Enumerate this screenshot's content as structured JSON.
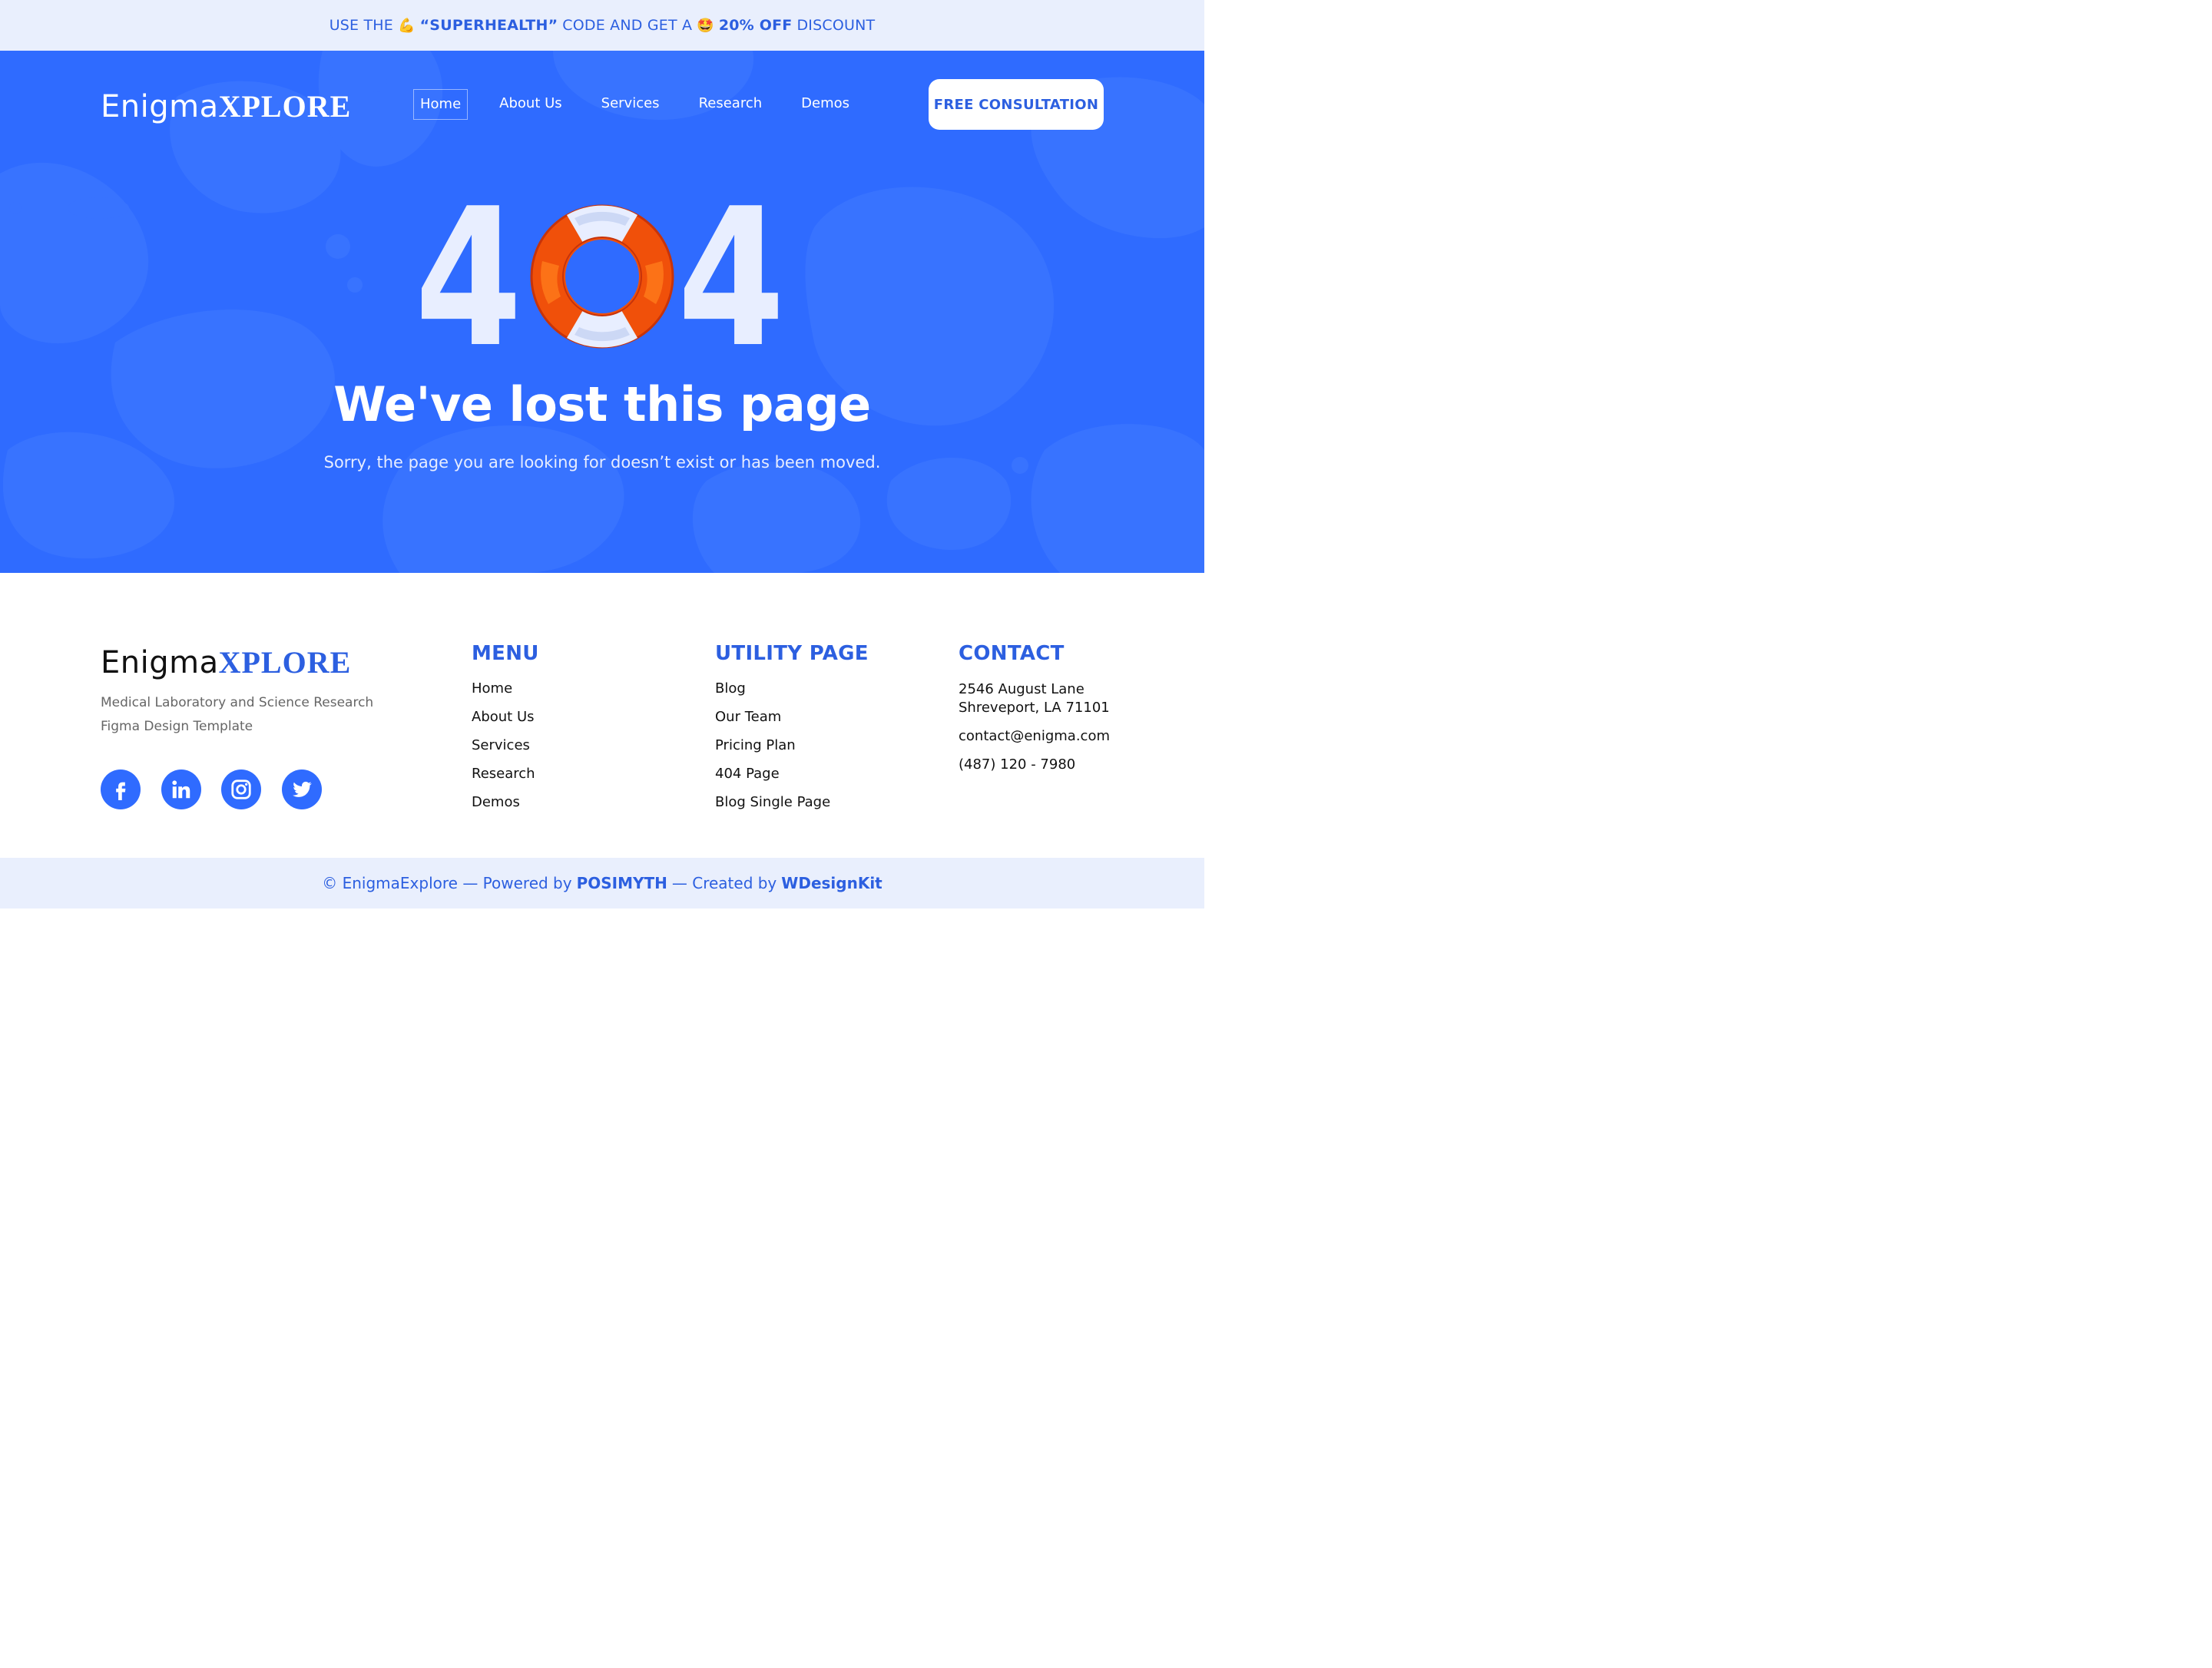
{
  "promo": {
    "prefix": "USE THE",
    "emoji1": "💪",
    "code": "“SUPERHEALTH”",
    "middle": "CODE AND GET A",
    "emoji2": "🤩",
    "discount": "20% OFF",
    "suffix": "DISCOUNT"
  },
  "brand": {
    "name_a": "Enigma",
    "name_b": "XPLORE"
  },
  "nav": {
    "items": [
      {
        "label": "Home",
        "active": true
      },
      {
        "label": "About Us"
      },
      {
        "label": "Services"
      },
      {
        "label": "Research"
      },
      {
        "label": "Demos"
      }
    ],
    "cta": "FREE CONSULTATION"
  },
  "hero": {
    "code_left": "4",
    "code_right": "4",
    "headline": "We've lost this page",
    "subline": "Sorry, the page you are looking for doesn’t exist or has been moved."
  },
  "footer": {
    "tagline": "Medical Laboratory and Science Research Figma Design Template",
    "socials": [
      "facebook-icon",
      "linkedin-icon",
      "instagram-icon",
      "twitter-icon"
    ],
    "menu": {
      "title": "MENU",
      "items": [
        "Home",
        "About Us",
        "Services",
        "Research",
        "Demos"
      ]
    },
    "utility": {
      "title": "UTILITY PAGE",
      "items": [
        "Blog",
        "Our Team",
        "Pricing Plan",
        "404 Page",
        "Blog Single Page"
      ]
    },
    "contact": {
      "title": "CONTACT",
      "address_line1": "2546 August Lane",
      "address_line2": "Shreveport, LA 71101",
      "email": "contact@enigma.com",
      "phone": "(487) 120 - 7980"
    }
  },
  "bottom": {
    "prefix": "© EnigmaExplore — Powered by",
    "powered": "POSIMYTH",
    "middle": "— Created by",
    "creator": "WDesignKit"
  },
  "colors": {
    "accent": "#2f6bff",
    "accent_text": "#2c5fe0",
    "lifebuoy": "#f0500a",
    "pale": "#e9effd"
  }
}
